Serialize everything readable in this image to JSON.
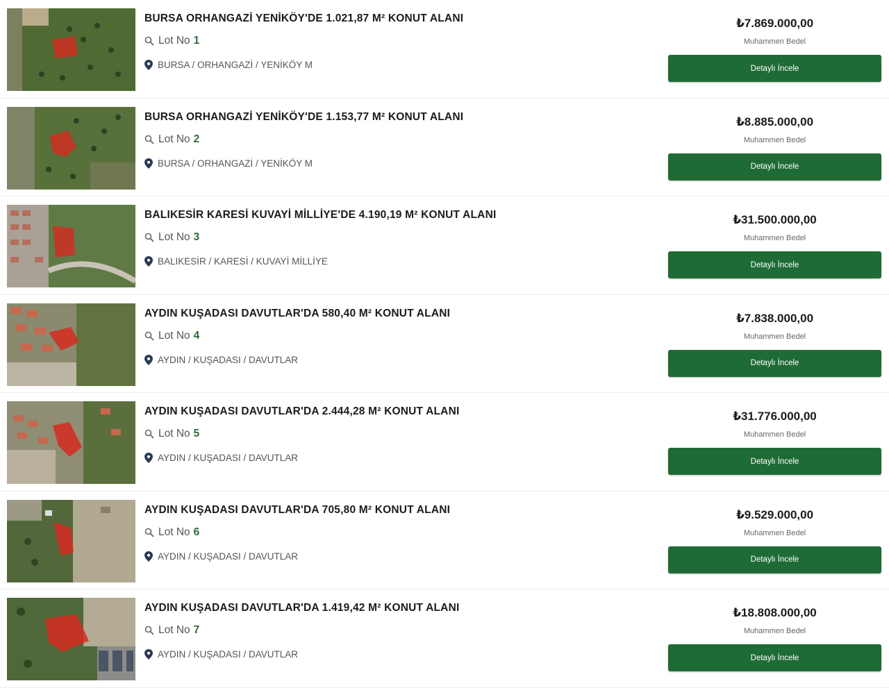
{
  "price_label": "Muhammen Bedel",
  "button_label": "Detaylı İncele",
  "lot_prefix": "Lot No",
  "colors": {
    "button": "#1f6b35",
    "lot_number": "#2e6b36",
    "plot": "#d62a20"
  },
  "listings": [
    {
      "title": "BURSA ORHANGAZİ YENİKÖY'DE 1.021,87 M² KONUT ALANI",
      "lot": "1",
      "location": "BURSA / ORHANGAZİ / YENİKÖY M",
      "price": "₺7.869.000,00"
    },
    {
      "title": "BURSA ORHANGAZİ YENİKÖY'DE 1.153,77 M² KONUT ALANI",
      "lot": "2",
      "location": "BURSA / ORHANGAZİ / YENİKÖY M",
      "price": "₺8.885.000,00"
    },
    {
      "title": "BALIKESİR KARESİ KUVAYİ MİLLİYE'DE 4.190,19 M² KONUT ALANI",
      "lot": "3",
      "location": "BALIKESİR / KARESİ / KUVAYİ MİLLİYE",
      "price": "₺31.500.000,00"
    },
    {
      "title": "AYDIN KUŞADASI DAVUTLAR'DA 580,40 M² KONUT ALANI",
      "lot": "4",
      "location": "AYDIN / KUŞADASI / DAVUTLAR",
      "price": "₺7.838.000,00"
    },
    {
      "title": "AYDIN KUŞADASI DAVUTLAR'DA 2.444,28 M² KONUT ALANI",
      "lot": "5",
      "location": "AYDIN / KUŞADASI / DAVUTLAR",
      "price": "₺31.776.000,00"
    },
    {
      "title": "AYDIN KUŞADASI DAVUTLAR'DA 705,80 M² KONUT ALANI",
      "lot": "6",
      "location": "AYDIN / KUŞADASI / DAVUTLAR",
      "price": "₺9.529.000,00"
    },
    {
      "title": "AYDIN KUŞADASI DAVUTLAR'DA 1.419,42 M² KONUT ALANI",
      "lot": "7",
      "location": "AYDIN / KUŞADASI / DAVUTLAR",
      "price": "₺18.808.000,00"
    }
  ]
}
